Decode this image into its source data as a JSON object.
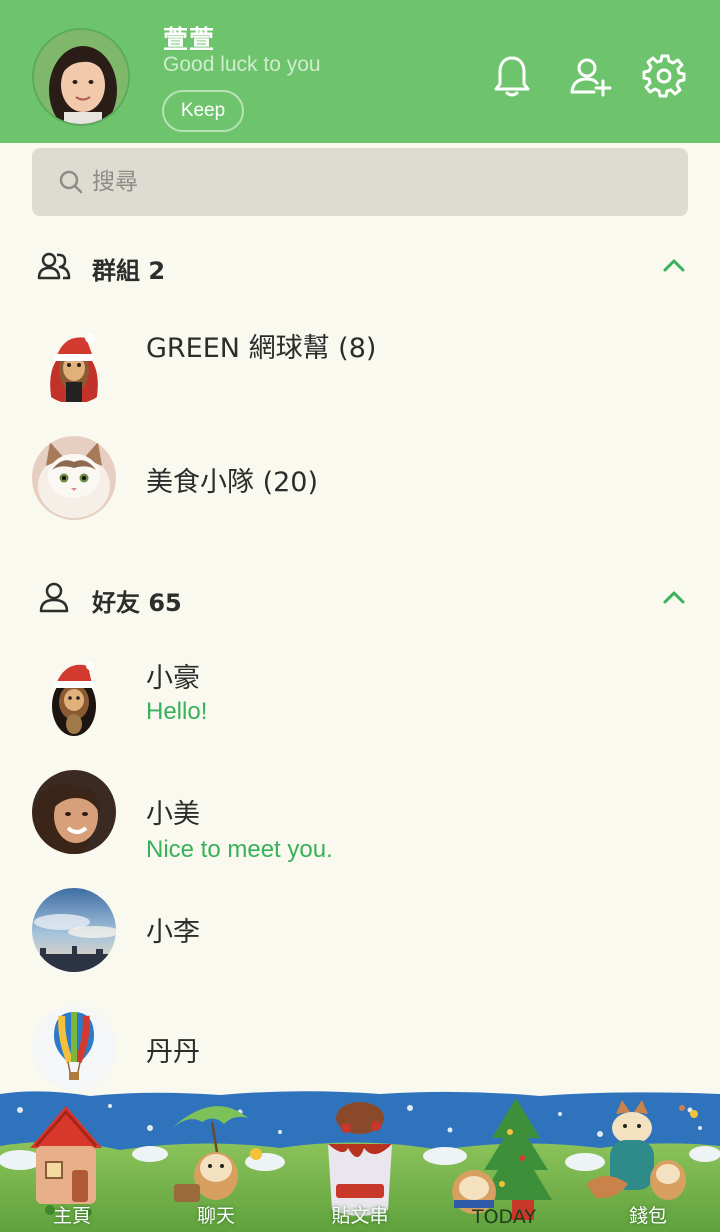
{
  "profile": {
    "name": "萱萱",
    "status": "Good luck to you",
    "keep_label": "Keep"
  },
  "search": {
    "placeholder": "搜尋"
  },
  "groups": {
    "title": "群組 2",
    "items": [
      {
        "name": "GREEN 網球幫 (8)"
      },
      {
        "name": "美食小隊 (20)"
      }
    ]
  },
  "friends": {
    "title": "好友 65",
    "items": [
      {
        "name": "小豪",
        "message": "Hello!"
      },
      {
        "name": "小美",
        "message": "Nice to meet you."
      },
      {
        "name": "小李",
        "message": ""
      },
      {
        "name": "丹丹",
        "message": ""
      }
    ]
  },
  "nav": {
    "items": [
      {
        "label": "主頁",
        "icon": "house-icon"
      },
      {
        "label": "聊天",
        "icon": "hamster-umbrella-icon"
      },
      {
        "label": "貼文串",
        "icon": "cake-icon"
      },
      {
        "label": "TODAY",
        "icon": "christmas-tree-icon"
      },
      {
        "label": "錢包",
        "icon": "cat-icon"
      }
    ]
  },
  "colors": {
    "header_bg": "#6ec46d",
    "body_bg": "#f9f9ef",
    "accent_green": "#39b05a",
    "search_bg": "#dcdcd3"
  }
}
